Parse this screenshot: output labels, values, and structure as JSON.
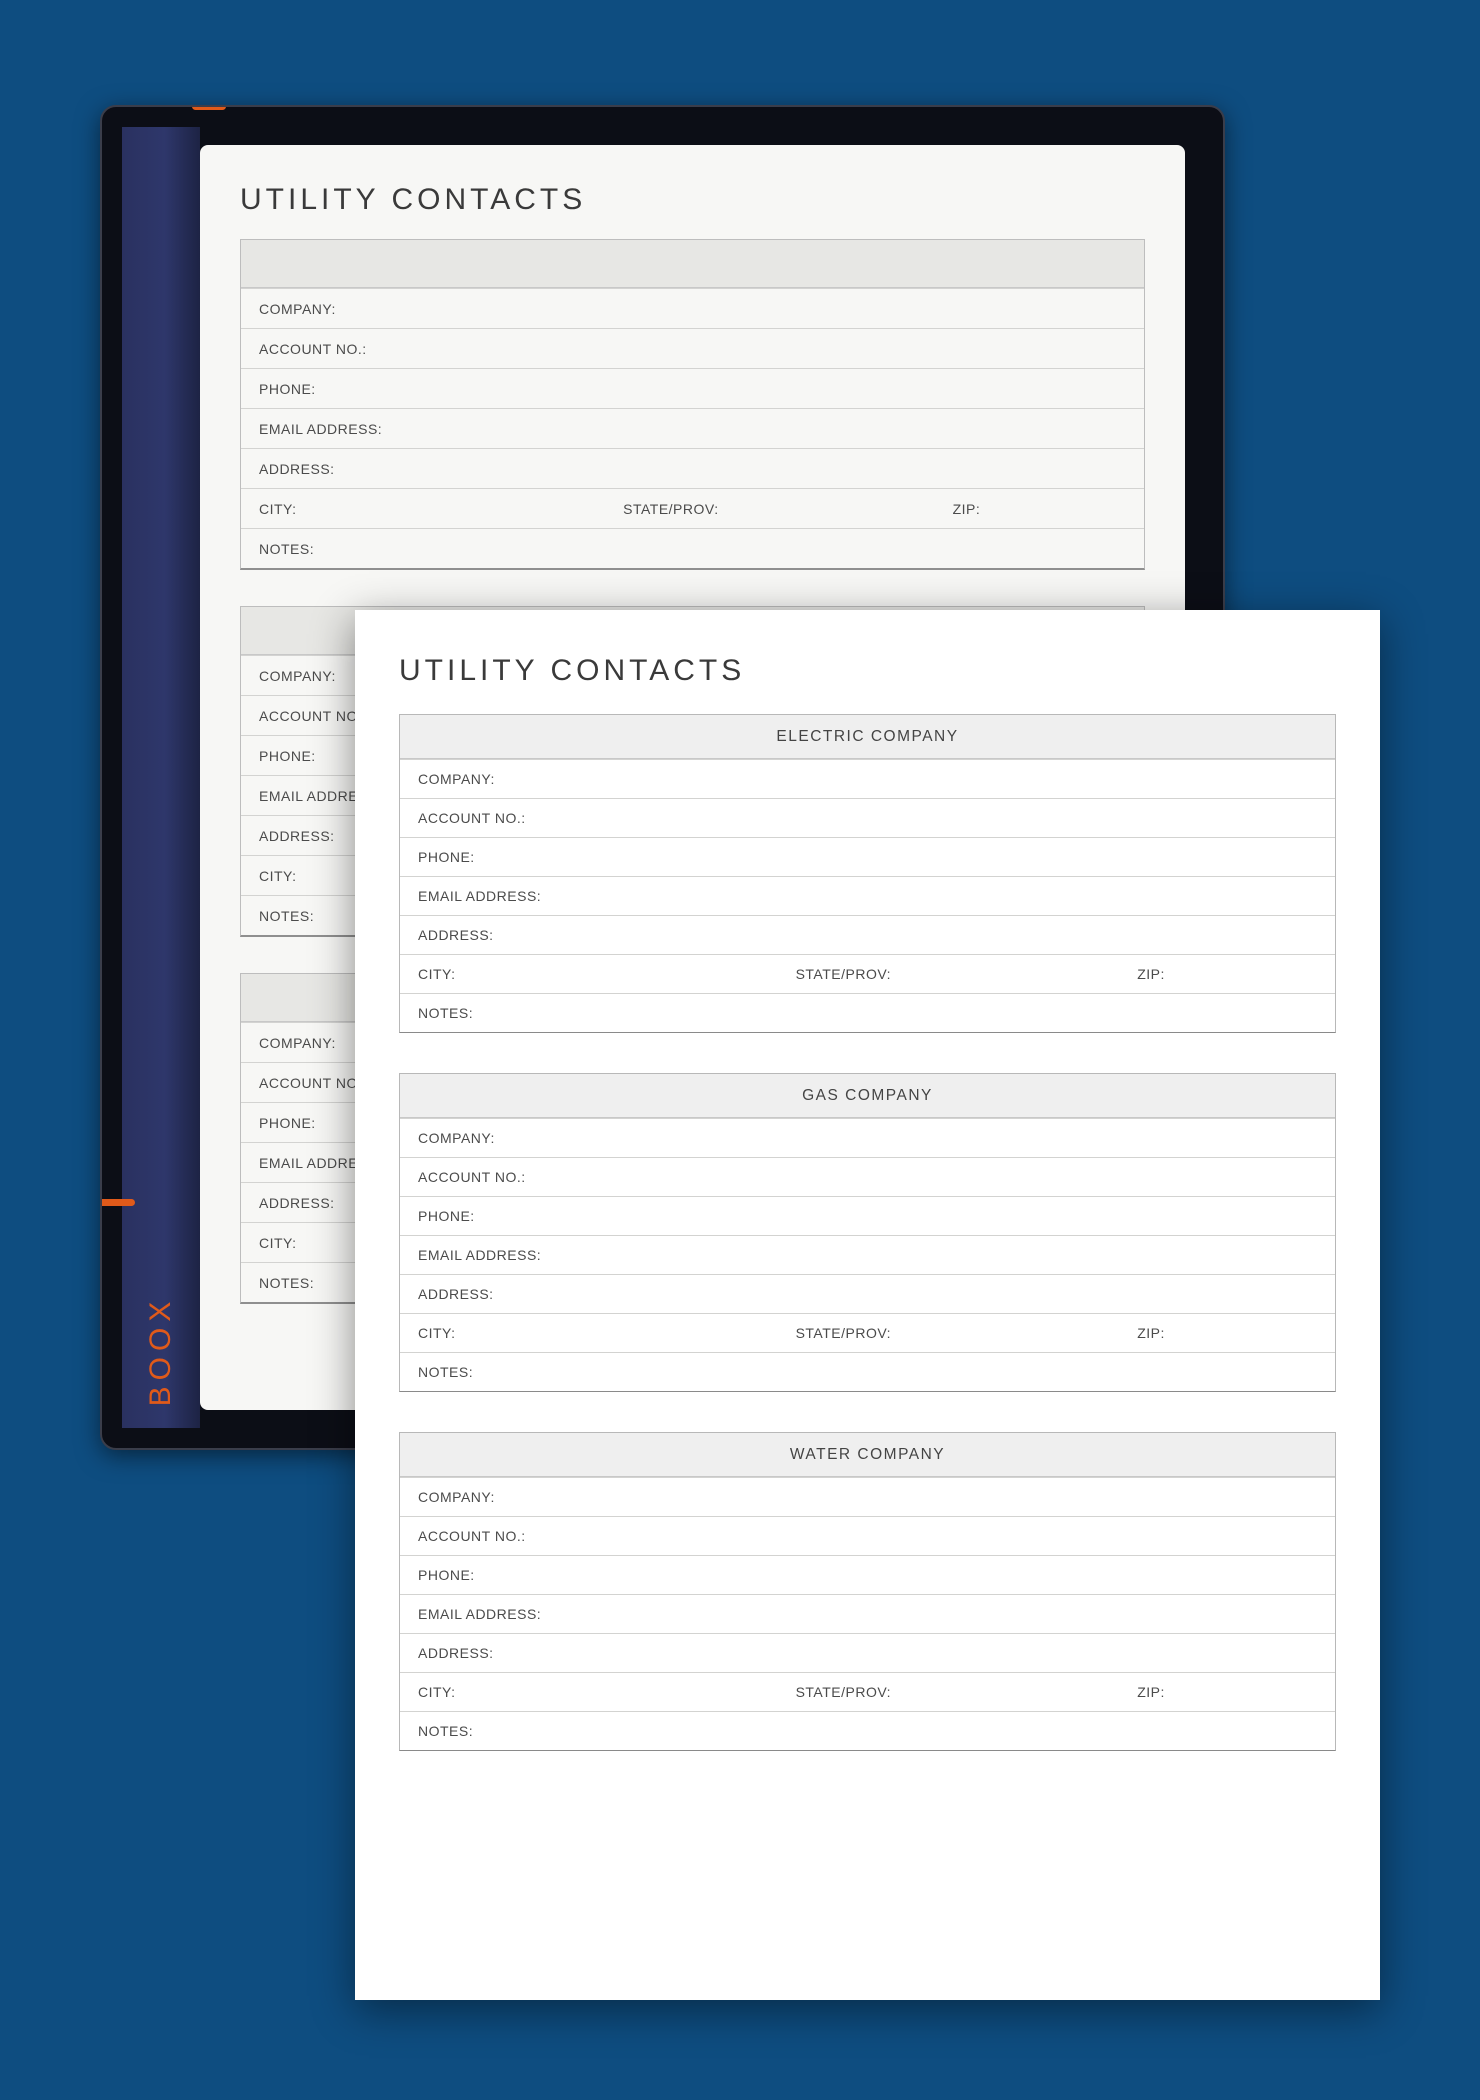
{
  "page_title": "UTILITY CONTACTS",
  "brand": "BOOX",
  "labels": {
    "company": "COMPANY:",
    "account": "ACCOUNT NO.:",
    "phone": "PHONE:",
    "email": "EMAIL ADDRESS:",
    "address": "ADDRESS:",
    "city": "CITY:",
    "state": "STATE/PROV:",
    "zip": "ZIP:",
    "notes": "NOTES:"
  },
  "tablet_sections": [
    {
      "title": ""
    },
    {
      "title": ""
    },
    {
      "title": ""
    }
  ],
  "sheet_sections": [
    {
      "title": "ELECTRIC COMPANY"
    },
    {
      "title": "GAS COMPANY"
    },
    {
      "title": "WATER COMPANY"
    }
  ]
}
